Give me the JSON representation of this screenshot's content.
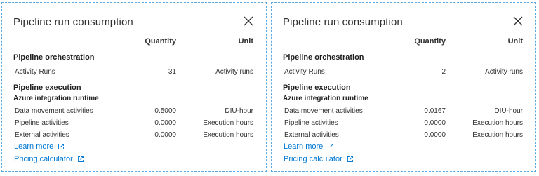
{
  "panels": [
    {
      "title": "Pipeline run consumption",
      "columns": {
        "quantity": "Quantity",
        "unit": "Unit"
      },
      "orchestration": {
        "heading": "Pipeline orchestration",
        "rows": [
          {
            "name": "Activity Runs",
            "quantity": "31",
            "unit": "Activity runs"
          }
        ]
      },
      "execution": {
        "heading": "Pipeline execution",
        "subheading": "Azure integration runtime",
        "rows": [
          {
            "name": "Data movement activities",
            "quantity": "0.5000",
            "unit": "DIU-hour"
          },
          {
            "name": "Pipeline activities",
            "quantity": "0.0000",
            "unit": "Execution hours"
          },
          {
            "name": "External activities",
            "quantity": "0.0000",
            "unit": "Execution hours"
          }
        ]
      },
      "links": {
        "learn_more": "Learn more",
        "pricing": "Pricing calculator"
      }
    },
    {
      "title": "Pipeline run consumption",
      "columns": {
        "quantity": "Quantity",
        "unit": "Unit"
      },
      "orchestration": {
        "heading": "Pipeline orchestration",
        "rows": [
          {
            "name": "Activity Runs",
            "quantity": "2",
            "unit": "Activity runs"
          }
        ]
      },
      "execution": {
        "heading": "Pipeline execution",
        "subheading": "Azure integration runtime",
        "rows": [
          {
            "name": "Data movement activities",
            "quantity": "0.0167",
            "unit": "DIU-hour"
          },
          {
            "name": "Pipeline activities",
            "quantity": "0.0000",
            "unit": "Execution hours"
          },
          {
            "name": "External activities",
            "quantity": "0.0000",
            "unit": "Execution hours"
          }
        ]
      },
      "links": {
        "learn_more": "Learn more",
        "pricing": "Pricing calculator"
      }
    }
  ],
  "icons": {
    "close": "close-icon",
    "external": "external-link-icon"
  },
  "colors": {
    "link": "#0078d4",
    "border": "#5aa9e0",
    "divider": "#c8c6c4"
  }
}
